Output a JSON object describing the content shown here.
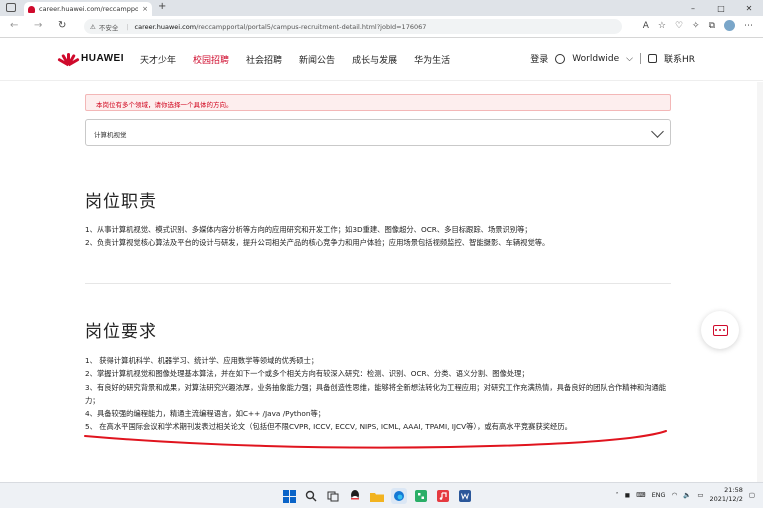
{
  "browser": {
    "tab_title": "career.huawei.com/reccampport",
    "tab_close": "×",
    "new_tab": "+",
    "back": "←",
    "forward": "→",
    "reload": "↻",
    "security_icon": "warning-triangle-icon",
    "insecure_label": "不安全",
    "url_domain": "career.huawei.com",
    "url_path": "/reccampportal/portal5/campus-recruitment-detail.html?jobId=176067",
    "window_controls": [
      "–",
      "□",
      "✕"
    ],
    "toolbar_icons": [
      "A",
      "☆",
      "♡",
      "✧",
      "⧉",
      "☆"
    ]
  },
  "site": {
    "logo_text": "HUAWEI",
    "nav": [
      "天才少年",
      "校园招聘",
      "社会招聘",
      "新闻公告",
      "成长与发展",
      "华为生活"
    ],
    "nav_active_index": 1,
    "login": "登录",
    "language": "Worldwide",
    "language_chevron": "⌵",
    "contact": "联系HR",
    "brand_color": "#cf0a2c"
  },
  "content": {
    "alert": "本岗位有多个领域，请你选择一个具体的方向。",
    "select_value": "计算机视觉",
    "responsibilities_title": "岗位职责",
    "responsibilities": [
      "1、从事计算机视觉、模式识别、多媒体内容分析等方向的应用研究和开发工作；如3D重建、图像超分、OCR、多目标跟踪、场景识别等；",
      "2、负责计算视觉核心算法及平台的设计与研发，提升公司相关产品的核心竞争力和用户体验；应用场景包括视频监控、智能摄影、车辆视觉等。"
    ],
    "requirements_title": "岗位要求",
    "requirements": [
      "1、 获得计算机科学、机器学习、统计学、应用数学等领域的优秀硕士；",
      "2、掌握计算机视觉和图像处理基本算法，并在如下一个或多个相关方向有较深入研究：检测、识别、OCR、分类、语义分割、图像处理；",
      "3、有良好的研究背景和成果，对算法研究兴趣浓厚，业务抽象能力强；具备创造性思维，能够将全新想法转化为工程应用；对研究工作充满热情，具备良好的团队合作精神和沟通能力；",
      "4、具备较强的编程能力，精通主流编程语言，如C++ /Java /Python等；",
      "5、 在高水平国际会议和学术期刊发表过相关论文（包括但不限CVPR, ICCV, ECCV, NIPS, ICML, AAAI, TPAMI, IJCV等），或有高水平竞赛获奖经历。"
    ]
  },
  "taskbar": {
    "apps": [
      {
        "icon": "windows-start-icon",
        "color": "#0a64c8"
      },
      {
        "icon": "search-icon",
        "color": "#333333"
      },
      {
        "icon": "task-view-icon",
        "color": "#333333"
      },
      {
        "icon": "qq-icon",
        "color": "#1e1e1e"
      },
      {
        "icon": "folder-icon",
        "color": "#f2b320"
      },
      {
        "icon": "edge-icon",
        "color": "#1478d4"
      },
      {
        "icon": "wechat-icon",
        "color": "#2aae67"
      },
      {
        "icon": "music-icon",
        "color": "#e53a40"
      },
      {
        "icon": "word-icon",
        "color": "#2b579a"
      }
    ],
    "language": "ENG",
    "time": "21:58",
    "date": "2021/12/2"
  },
  "annotation": {
    "color": "#e0141e"
  }
}
